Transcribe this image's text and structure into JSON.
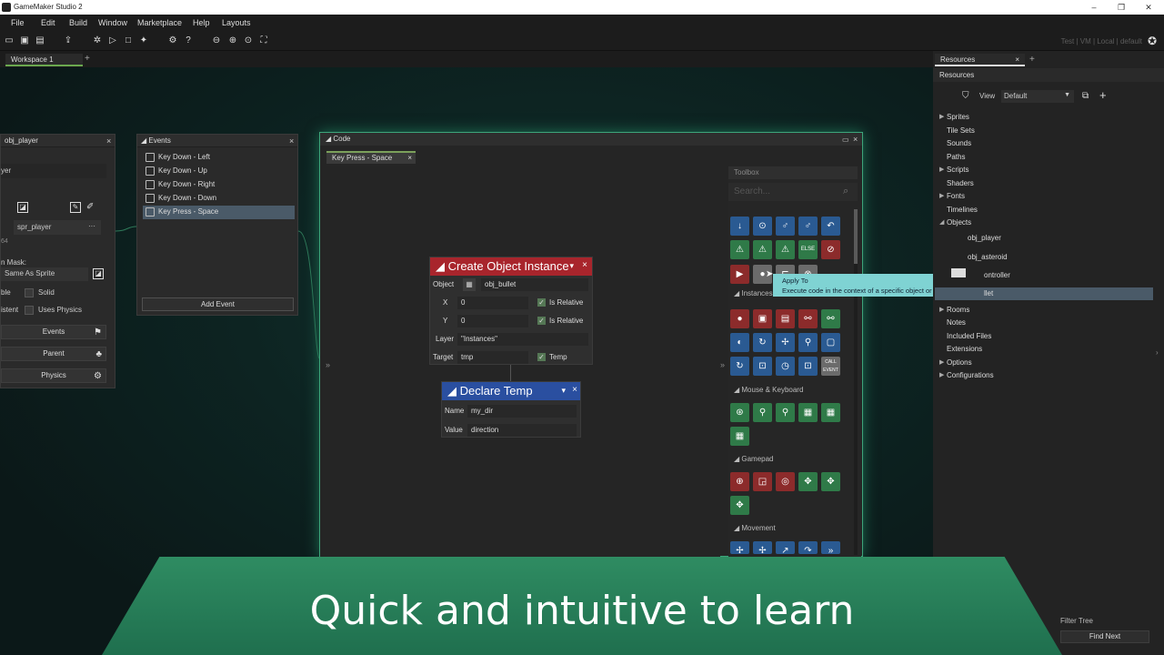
{
  "app": {
    "title": "GameMaker Studio 2"
  },
  "menu": [
    "File",
    "Edit",
    "Build",
    "Window",
    "Marketplace",
    "Help",
    "Layouts"
  ],
  "toolbar_right": "Test | VM | Local | default",
  "workspace_tab": "Workspace 1",
  "object_panel": {
    "title": "obj_player",
    "name_partial": "yer",
    "sprite": "spr_player",
    "sprite_dims": "64",
    "collision_label": "n Mask:",
    "collision_value": "Same As Sprite",
    "visible_label": "ble",
    "solid": "Solid",
    "persistent_label": "istent",
    "uses_physics": "Uses Physics",
    "buttons": [
      "Events",
      "Parent",
      "Physics"
    ]
  },
  "events_panel": {
    "title": "Events",
    "items": [
      "Key Down - Left",
      "Key Down - Up",
      "Key Down - Right",
      "Key Down - Down",
      "Key Press - Space"
    ],
    "add_button": "Add Event"
  },
  "code_panel": {
    "title": "Code",
    "tab": "Key Press - Space"
  },
  "create_block": {
    "title": "Create Object Instance",
    "object_label": "Object",
    "object_value": "obj_bullet",
    "x_label": "X",
    "x_value": "0",
    "y_label": "Y",
    "y_value": "0",
    "relative_label": "Is Relative",
    "layer_label": "Layer",
    "layer_value": "\"Instances\"",
    "target_label": "Target",
    "target_value": "tmp",
    "temp_label": "Temp"
  },
  "declare_block": {
    "title": "Declare Temp",
    "name_label": "Name",
    "name_value": "my_dir",
    "value_label": "Value",
    "value_value": "direction"
  },
  "toolbox": {
    "title": "Toolbox",
    "search_placeholder": "Search...",
    "sections": [
      "Instances",
      "Mouse & Keyboard",
      "Gamepad",
      "Movement"
    ],
    "else_label": "ELSE",
    "call_label": "CALL EVENT"
  },
  "tooltip": {
    "title": "Apply To",
    "desc": "Execute code in the context of a specific object or instance."
  },
  "resources": {
    "tab": "Resources",
    "header": "Resources",
    "view_label": "View",
    "view_value": "Default",
    "tree": [
      "Sprites",
      "Tile Sets",
      "Sounds",
      "Paths",
      "Scripts",
      "Shaders",
      "Fonts",
      "Timelines",
      "Objects"
    ],
    "objects": [
      "obj_player",
      "obj_asteroid",
      "ontroller",
      "llet"
    ],
    "tree2": [
      "Rooms",
      "Notes",
      "Included Files",
      "Extensions",
      "Options",
      "Configurations"
    ],
    "filter": "Filter Tree",
    "find_next": "Find Next"
  },
  "banner": {
    "text": "Quick and intuitive to learn"
  },
  "colors": {
    "accent": "#3da57a",
    "create_header": "#a8252c",
    "declare_header": "#2a4fa0",
    "tooltip": "#7fd3d3"
  }
}
